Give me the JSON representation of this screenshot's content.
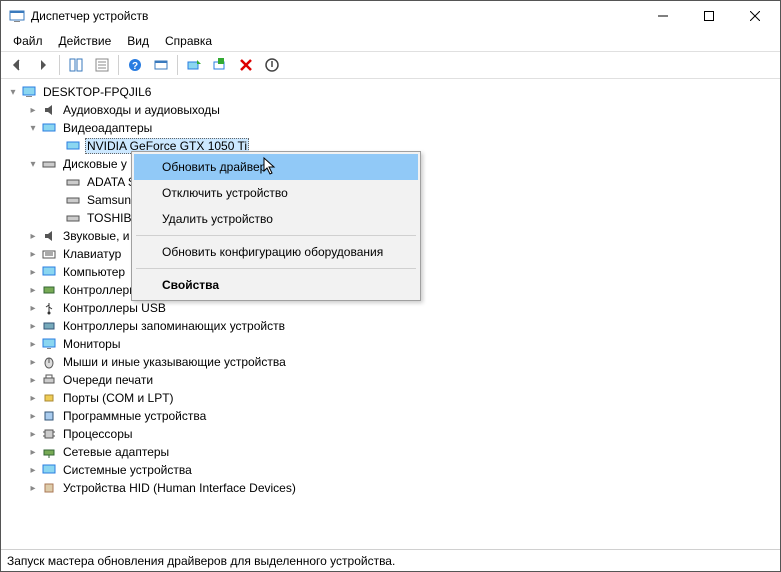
{
  "window": {
    "title": "Диспетчер устройств"
  },
  "menu": {
    "file": "Файл",
    "action": "Действие",
    "view": "Вид",
    "help": "Справка"
  },
  "tree": {
    "root": "DESKTOP-FPQJIL6",
    "cat_audio": "Аудиовходы и аудиовыходы",
    "cat_video": "Видеоадаптеры",
    "dev_gpu": "NVIDIA GeForce GTX 1050 Ti",
    "cat_disk": "Дисковые у",
    "dev_adata": "ADATA S",
    "dev_samsung": "Samsun",
    "dev_toshiba": "TOSHIBA",
    "cat_sound": "Звуковые, и",
    "cat_keyboard": "Клавиатур",
    "cat_computer": "Компьютер",
    "cat_ide": "Контроллеры IDE ATA/ATAPI",
    "cat_usb": "Контроллеры USB",
    "cat_storage": "Контроллеры запоминающих устройств",
    "cat_monitor": "Мониторы",
    "cat_mouse": "Мыши и иные указывающие устройства",
    "cat_printq": "Очереди печати",
    "cat_ports": "Порты (COM и LPT)",
    "cat_swdev": "Программные устройства",
    "cat_cpu": "Процессоры",
    "cat_net": "Сетевые адаптеры",
    "cat_sys": "Системные устройства",
    "cat_hid": "Устройства HID (Human Interface Devices)"
  },
  "context": {
    "update": "Обновить драйвер",
    "disable": "Отключить устройство",
    "remove": "Удалить устройство",
    "scan": "Обновить конфигурацию оборудования",
    "props": "Свойства"
  },
  "status": "Запуск мастера обновления драйверов для выделенного устройства."
}
